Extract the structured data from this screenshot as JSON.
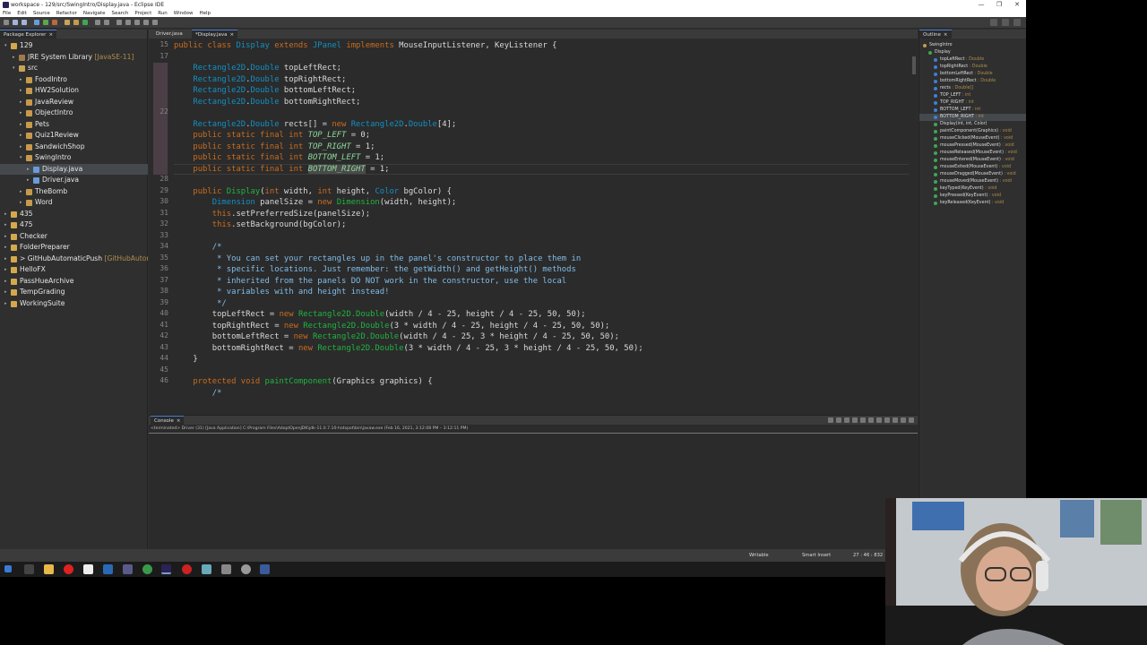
{
  "window": {
    "title": "workspace - 129/src/SwingIntro/Display.java - Eclipse IDE",
    "controls": [
      "—",
      "❐",
      "✕"
    ]
  },
  "menu": [
    "File",
    "Edit",
    "Source",
    "Refactor",
    "Navigate",
    "Search",
    "Project",
    "Run",
    "Window",
    "Help"
  ],
  "package_explorer": {
    "tab_label": "Package Explorer",
    "items": [
      {
        "label": "129",
        "decoration": "",
        "arrow": "▾",
        "icon": "project-icon",
        "icon_color": "#d4a84c"
      },
      {
        "label": "JRE System Library",
        "decoration": " [JavaSE-11]",
        "arrow": "▸",
        "icon": "library-icon",
        "icon_color": "#a07a4a"
      },
      {
        "label": "src",
        "decoration": "",
        "arrow": "▾",
        "icon": "source-folder-icon",
        "icon_color": "#c7a35a"
      },
      {
        "label": "FoodIntro",
        "decoration": "",
        "arrow": "▸",
        "icon": "package-icon",
        "icon_color": "#c79a4b"
      },
      {
        "label": "HW2Solution",
        "decoration": "",
        "arrow": "▸",
        "icon": "package-icon",
        "icon_color": "#c79a4b"
      },
      {
        "label": "JavaReview",
        "decoration": "",
        "arrow": "▸",
        "icon": "package-icon",
        "icon_color": "#c79a4b"
      },
      {
        "label": "ObjectIntro",
        "decoration": "",
        "arrow": "▸",
        "icon": "package-icon",
        "icon_color": "#c79a4b"
      },
      {
        "label": "Pets",
        "decoration": "",
        "arrow": "▸",
        "icon": "package-icon",
        "icon_color": "#c79a4b"
      },
      {
        "label": "Quiz1Review",
        "decoration": "",
        "arrow": "▸",
        "icon": "package-icon",
        "icon_color": "#c79a4b"
      },
      {
        "label": "SandwichShop",
        "decoration": "",
        "arrow": "▸",
        "icon": "package-icon",
        "icon_color": "#c79a4b"
      },
      {
        "label": "SwingIntro",
        "decoration": "",
        "arrow": "▾",
        "icon": "package-icon",
        "icon_color": "#c79a4b"
      },
      {
        "label": "Display.java",
        "decoration": "",
        "arrow": "▸",
        "icon": "java-file-icon",
        "icon_color": "#6a9bd8"
      },
      {
        "label": "Driver.java",
        "decoration": "",
        "arrow": "▸",
        "icon": "java-file-icon",
        "icon_color": "#6a9bd8"
      },
      {
        "label": "TheBomb",
        "decoration": "",
        "arrow": "▸",
        "icon": "package-icon",
        "icon_color": "#c79a4b"
      },
      {
        "label": "Word",
        "decoration": "",
        "arrow": "▸",
        "icon": "package-icon",
        "icon_color": "#c79a4b"
      },
      {
        "label": "435",
        "decoration": "",
        "arrow": "▸",
        "icon": "project-icon",
        "icon_color": "#d4a84c"
      },
      {
        "label": "475",
        "decoration": "",
        "arrow": "▸",
        "icon": "project-icon",
        "icon_color": "#d4a84c"
      },
      {
        "label": "Checker",
        "decoration": "",
        "arrow": "▸",
        "icon": "project-icon",
        "icon_color": "#d4a84c"
      },
      {
        "label": "FolderPreparer",
        "decoration": "",
        "arrow": "▸",
        "icon": "project-icon",
        "icon_color": "#d4a84c"
      },
      {
        "label": "> GitHubAutomaticPush",
        "decoration": " [GitHubAutom",
        "arrow": "▸",
        "icon": "project-icon",
        "icon_color": "#d4a84c"
      },
      {
        "label": "HelloFX",
        "decoration": "",
        "arrow": "▸",
        "icon": "project-icon",
        "icon_color": "#d4a84c"
      },
      {
        "label": "PassHueArchive",
        "decoration": "",
        "arrow": "▸",
        "icon": "project-icon",
        "icon_color": "#d4a84c"
      },
      {
        "label": "TempGrading",
        "decoration": "",
        "arrow": "▸",
        "icon": "project-icon",
        "icon_color": "#d4a84c"
      },
      {
        "label": "WorkingSuite",
        "decoration": "",
        "arrow": "▸",
        "icon": "project-icon",
        "icon_color": "#d4a84c"
      }
    ]
  },
  "editor": {
    "tabs": [
      {
        "label": "Driver.java",
        "active": false
      },
      {
        "label": "*Display.java",
        "active": true
      }
    ],
    "line_numbers": [
      "15",
      "17",
      "",
      "",
      "",
      "",
      "22",
      "",
      "",
      "",
      "",
      "",
      "28",
      "29",
      "30",
      "31",
      "32",
      "33",
      "34",
      "35",
      "36",
      "37",
      "38",
      "39",
      "40",
      "41",
      "42",
      "43",
      "44",
      "45",
      "46",
      ""
    ],
    "lines": [
      [
        [
          "kw",
          "public class "
        ],
        [
          "ty",
          "Display"
        ],
        [
          "kw",
          " extends "
        ],
        [
          "ty",
          "JPanel"
        ],
        [
          "kw",
          " implements "
        ],
        [
          "pl",
          "MouseInputListener, KeyListener {"
        ]
      ],
      [],
      [
        [
          "pl",
          "    "
        ],
        [
          "ty",
          "Rectangle2D"
        ],
        [
          "pl",
          "."
        ],
        [
          "ty",
          "Double"
        ],
        [
          "pl",
          " topLeftRect;"
        ]
      ],
      [
        [
          "pl",
          "    "
        ],
        [
          "ty",
          "Rectangle2D"
        ],
        [
          "pl",
          "."
        ],
        [
          "ty",
          "Double"
        ],
        [
          "pl",
          " topRightRect;"
        ]
      ],
      [
        [
          "pl",
          "    "
        ],
        [
          "ty",
          "Rectangle2D"
        ],
        [
          "pl",
          "."
        ],
        [
          "ty",
          "Double"
        ],
        [
          "pl",
          " bottomLeftRect;"
        ]
      ],
      [
        [
          "pl",
          "    "
        ],
        [
          "ty",
          "Rectangle2D"
        ],
        [
          "pl",
          "."
        ],
        [
          "ty",
          "Double"
        ],
        [
          "pl",
          " bottomRightRect;"
        ]
      ],
      [],
      [
        [
          "pl",
          "    "
        ],
        [
          "ty",
          "Rectangle2D"
        ],
        [
          "pl",
          "."
        ],
        [
          "ty",
          "Double"
        ],
        [
          "pl",
          " rects[] = "
        ],
        [
          "kw",
          "new "
        ],
        [
          "ty",
          "Rectangle2D"
        ],
        [
          "pl",
          "."
        ],
        [
          "ty",
          "Double"
        ],
        [
          "pl",
          "[4];"
        ]
      ],
      [
        [
          "pl",
          "    "
        ],
        [
          "kw",
          "public static final int "
        ],
        [
          "cn",
          "TOP_LEFT"
        ],
        [
          "pl",
          " = 0;"
        ]
      ],
      [
        [
          "pl",
          "    "
        ],
        [
          "kw",
          "public static final int "
        ],
        [
          "cn",
          "TOP_RIGHT"
        ],
        [
          "pl",
          " = 1;"
        ]
      ],
      [
        [
          "pl",
          "    "
        ],
        [
          "kw",
          "public static final int "
        ],
        [
          "cn",
          "BOTTOM_LEFT"
        ],
        [
          "pl",
          " = 1;"
        ]
      ],
      [
        [
          "pl",
          "    "
        ],
        [
          "kw",
          "public static final int "
        ],
        [
          "hl",
          "BOTTOM_RIGHT"
        ],
        [
          "pl",
          " = 1;"
        ]
      ],
      [],
      [
        [
          "pl",
          "    "
        ],
        [
          "kw",
          "public "
        ],
        [
          "fn",
          "Display"
        ],
        [
          "pl",
          "("
        ],
        [
          "kw",
          "int"
        ],
        [
          "pl",
          " width, "
        ],
        [
          "kw",
          "int"
        ],
        [
          "pl",
          " height, "
        ],
        [
          "ty",
          "Color"
        ],
        [
          "pl",
          " bgColor) {"
        ]
      ],
      [
        [
          "pl",
          "        "
        ],
        [
          "ty",
          "Dimension"
        ],
        [
          "pl",
          " panelSize = "
        ],
        [
          "kw",
          "new "
        ],
        [
          "fn",
          "Dimension"
        ],
        [
          "pl",
          "(width, height);"
        ]
      ],
      [
        [
          "pl",
          "        "
        ],
        [
          "kw",
          "this"
        ],
        [
          "pl",
          ".setPreferredSize(panelSize);"
        ]
      ],
      [
        [
          "pl",
          "        "
        ],
        [
          "kw",
          "this"
        ],
        [
          "pl",
          ".setBackground(bgColor);"
        ]
      ],
      [],
      [
        [
          "cm",
          "        /*"
        ]
      ],
      [
        [
          "cm",
          "         * You can set your rectangles up in the panel's constructor to place them in"
        ]
      ],
      [
        [
          "cm",
          "         * specific locations. Just remember: the getWidth() and getHeight() methods"
        ]
      ],
      [
        [
          "cm",
          "         * inherited from the panels DO NOT work in the constructor, use the local"
        ]
      ],
      [
        [
          "cm",
          "         * variables with and height instead!"
        ]
      ],
      [
        [
          "cm",
          "         */"
        ]
      ],
      [
        [
          "pl",
          "        topLeftRect = "
        ],
        [
          "kw",
          "new "
        ],
        [
          "fn",
          "Rectangle2D.Double"
        ],
        [
          "pl",
          "(width / 4 - 25, height / 4 - 25, 50, 50);"
        ]
      ],
      [
        [
          "pl",
          "        topRightRect = "
        ],
        [
          "kw",
          "new "
        ],
        [
          "fn",
          "Rectangle2D.Double"
        ],
        [
          "pl",
          "(3 * width / 4 - 25, height / 4 - 25, 50, 50);"
        ]
      ],
      [
        [
          "pl",
          "        bottomLeftRect = "
        ],
        [
          "kw",
          "new "
        ],
        [
          "fn",
          "Rectangle2D.Double"
        ],
        [
          "pl",
          "(width / 4 - 25, 3 * height / 4 - 25, 50, 50);"
        ]
      ],
      [
        [
          "pl",
          "        bottomRightRect = "
        ],
        [
          "kw",
          "new "
        ],
        [
          "fn",
          "Rectangle2D.Double"
        ],
        [
          "pl",
          "(3 * width / 4 - 25, 3 * height / 4 - 25, 50, 50);"
        ]
      ],
      [
        [
          "pl",
          "    }"
        ]
      ],
      [],
      [
        [
          "pl",
          "    "
        ],
        [
          "kw",
          "protected void "
        ],
        [
          "fn",
          "paintComponent"
        ],
        [
          "pl",
          "(Graphics graphics) {"
        ]
      ],
      [
        [
          "cm",
          "        /*"
        ]
      ]
    ]
  },
  "outline": {
    "tab_label": "Outline",
    "items": [
      {
        "label": "SwingIntro",
        "type": "",
        "color": "#c79a4b"
      },
      {
        "label": "Display",
        "type": "",
        "color": "#3fa654"
      },
      {
        "label": "topLeftRect",
        "type": " : Double",
        "color": "#3f7fd6"
      },
      {
        "label": "topRightRect",
        "type": " : Double",
        "color": "#3f7fd6"
      },
      {
        "label": "bottomLeftRect",
        "type": " : Double",
        "color": "#3f7fd6"
      },
      {
        "label": "bottomRightRect",
        "type": " : Double",
        "color": "#3f7fd6"
      },
      {
        "label": "rects",
        "type": " : Double[]",
        "color": "#3f7fd6"
      },
      {
        "label": "TOP_LEFT",
        "type": " : int",
        "color": "#3f7fd6"
      },
      {
        "label": "TOP_RIGHT",
        "type": " : int",
        "color": "#3f7fd6"
      },
      {
        "label": "BOTTOM_LEFT",
        "type": " : int",
        "color": "#3f7fd6"
      },
      {
        "label": "BOTTOM_RIGHT",
        "type": " : int",
        "color": "#3f7fd6"
      },
      {
        "label": "Display(int, int, Color)",
        "type": "",
        "color": "#3fa654"
      },
      {
        "label": "paintComponent(Graphics)",
        "type": " : void",
        "color": "#3fa654"
      },
      {
        "label": "mouseClicked(MouseEvent)",
        "type": " : void",
        "color": "#3fa654"
      },
      {
        "label": "mousePressed(MouseEvent)",
        "type": " : void",
        "color": "#3fa654"
      },
      {
        "label": "mouseReleased(MouseEvent)",
        "type": " : void",
        "color": "#3fa654"
      },
      {
        "label": "mouseEntered(MouseEvent)",
        "type": " : void",
        "color": "#3fa654"
      },
      {
        "label": "mouseExited(MouseEvent)",
        "type": " : void",
        "color": "#3fa654"
      },
      {
        "label": "mouseDragged(MouseEvent)",
        "type": " : void",
        "color": "#3fa654"
      },
      {
        "label": "mouseMoved(MouseEvent)",
        "type": " : void",
        "color": "#3fa654"
      },
      {
        "label": "keyTyped(KeyEvent)",
        "type": " : void",
        "color": "#3fa654"
      },
      {
        "label": "keyPressed(KeyEvent)",
        "type": " : void",
        "color": "#3fa654"
      },
      {
        "label": "keyReleased(KeyEvent)",
        "type": " : void",
        "color": "#3fa654"
      }
    ]
  },
  "console": {
    "tab_label": "Console",
    "info": "<terminated> Driver (31) [Java Application] C:\\Program Files\\AdoptOpenJDK\\jdk-11.0.7.10-hotspot\\bin\\javaw.exe (Feb 16, 2021, 3:12:08 PM – 3:12:11 PM)"
  },
  "status": {
    "writable": "Writable",
    "insert_mode": "Smart Insert",
    "position": "27 : 46 : 832"
  },
  "colors": {
    "keyword": "#cc6c1d",
    "type": "#1290c3",
    "constant": "#8dda9c",
    "method": "#1eb540",
    "comment": "#80bdea",
    "accent": "#4a7fd6"
  }
}
